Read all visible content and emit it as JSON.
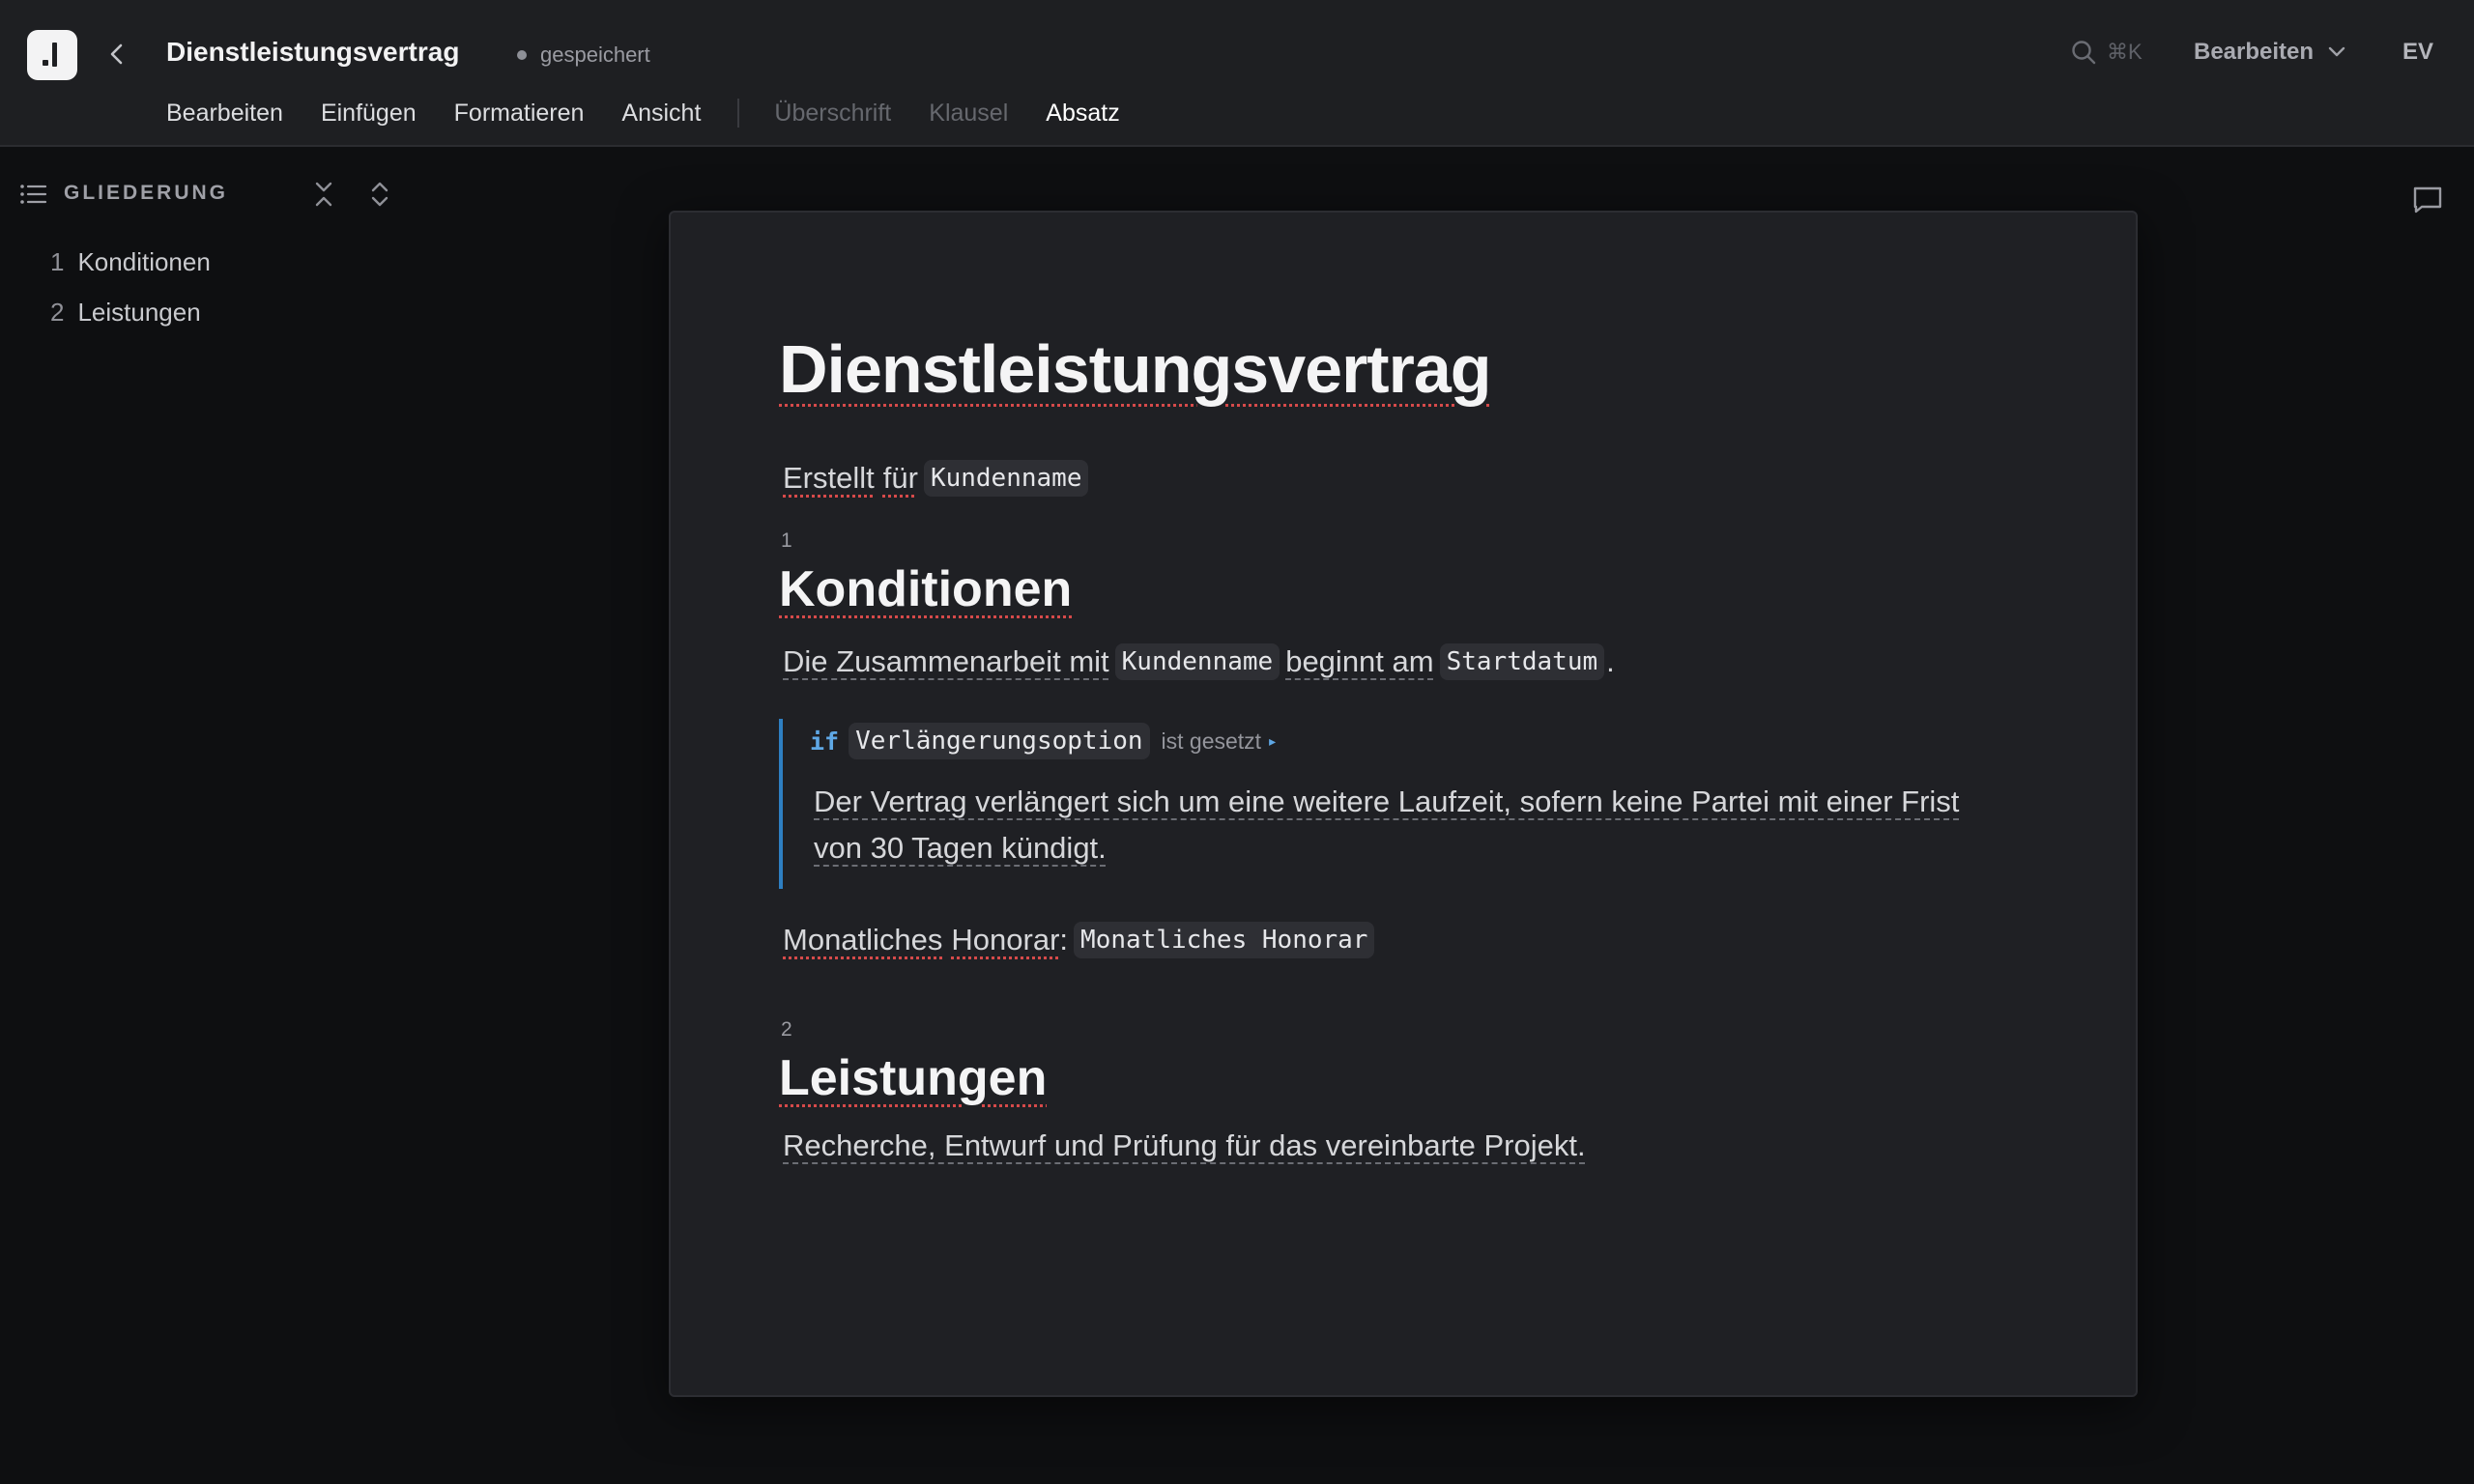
{
  "app": {
    "title": "Dienstleistungsvertrag",
    "save_status": "gespeichert"
  },
  "header": {
    "search_shortcut": "⌘K",
    "mode_label": "Bearbeiten",
    "avatar_initials": "EV"
  },
  "menu": {
    "items": [
      "Bearbeiten",
      "Einfügen",
      "Formatieren",
      "Ansicht"
    ],
    "block_types": [
      "Überschrift",
      "Klausel",
      "Absatz"
    ],
    "active_block_type": "Absatz"
  },
  "sidebar": {
    "title": "GLIEDERUNG",
    "items": [
      {
        "num": "1",
        "label": "Konditionen"
      },
      {
        "num": "2",
        "label": "Leistungen"
      }
    ]
  },
  "document": {
    "title": "Dienstleistungsvertrag",
    "intro": {
      "text_1": "Erstellt",
      "text_2": "für",
      "var": "Kundenname"
    },
    "sections": [
      {
        "num": "1",
        "heading": "Konditionen",
        "para": {
          "text_1": "Die Zusammenarbeit mit",
          "var_1": "Kundenname",
          "text_2": "beginnt am",
          "var_2": "Startdatum",
          "text_3": "."
        },
        "condition": {
          "keyword": "if",
          "variable": "Verlängerungsoption",
          "operator": "ist gesetzt",
          "body": "Der Vertrag verlängert sich um eine weitere Laufzeit, sofern keine Partei mit einer Frist von 30 Tagen kündigt."
        },
        "fee": {
          "label_1": "Monatliches",
          "label_2": "Honorar",
          "colon": ":",
          "var": "Monatliches Honorar"
        }
      },
      {
        "num": "2",
        "heading": "Leistungen",
        "para": "Recherche, Entwurf und Prüfung für das vereinbarte Projekt."
      }
    ]
  },
  "colors": {
    "accent_blue": "#2e7fc2",
    "spell_error": "#d64a4a",
    "page_bg": "#1f2024",
    "app_bg": "#0e0f11"
  },
  "icons": [
    "app-logo-icon",
    "chevron-left-icon",
    "search-icon",
    "chevron-down-icon",
    "list-icon",
    "collapse-all-icon",
    "expand-all-icon",
    "comment-icon"
  ]
}
